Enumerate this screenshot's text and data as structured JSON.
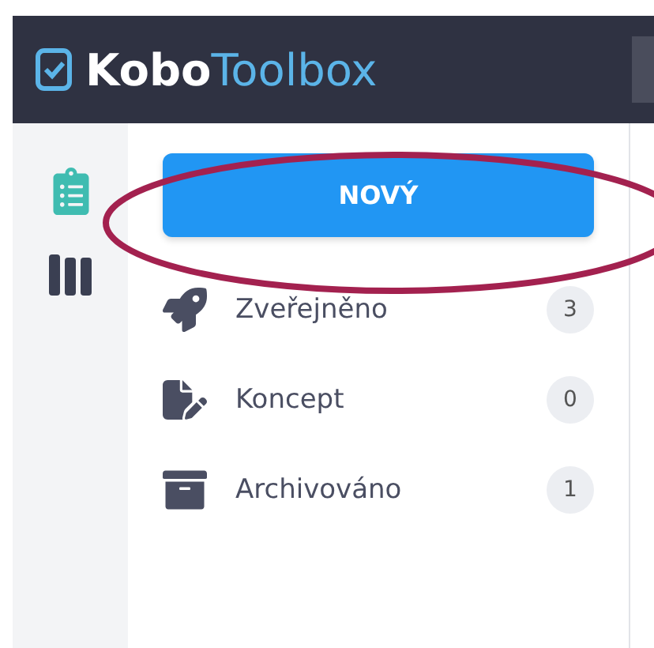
{
  "header": {
    "logo": {
      "primary": "Kobo",
      "secondary": "Toolbox"
    }
  },
  "rail": [
    {
      "kind": "projects",
      "selected": true
    },
    {
      "kind": "library",
      "selected": false
    }
  ],
  "new_button": {
    "label": "NOVÝ",
    "highlighted": true
  },
  "nav": [
    {
      "kind": "deployed",
      "label": "Zveřejněno",
      "count": "3"
    },
    {
      "kind": "draft",
      "label": "Koncept",
      "count": "0"
    },
    {
      "kind": "archived",
      "label": "Archivováno",
      "count": "1"
    }
  ]
}
